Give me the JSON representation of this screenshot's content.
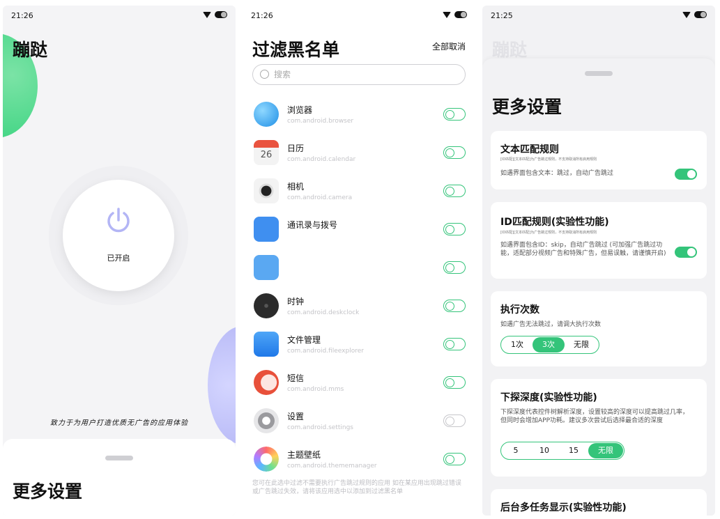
{
  "screens": {
    "main": {
      "time": "21:26",
      "app_title": "蹦跶",
      "power_label": "已开启",
      "slogan": "致力于为用户打造优质无广告的应用体验",
      "sheet_title": "更多设置"
    },
    "blacklist": {
      "time": "21:26",
      "title": "过滤黑名单",
      "deselect_all": "全部取消",
      "search_placeholder": "搜索",
      "apps": [
        {
          "name": "浏览器",
          "pkg": "com.android.browser",
          "on": false
        },
        {
          "name": "日历",
          "pkg": "com.android.calendar",
          "on": false
        },
        {
          "name": "相机",
          "pkg": "com.android.camera",
          "on": false
        },
        {
          "name": "通讯录与拨号",
          "pkg": "",
          "on": false
        },
        {
          "name": "",
          "pkg": "",
          "on": false
        },
        {
          "name": "时钟",
          "pkg": "com.android.deskclock",
          "on": false
        },
        {
          "name": "文件管理",
          "pkg": "com.android.fileexplorer",
          "on": false
        },
        {
          "name": "短信",
          "pkg": "com.android.mms",
          "on": false
        },
        {
          "name": "设置",
          "pkg": "com.android.settings",
          "on": false
        },
        {
          "name": "主题壁纸",
          "pkg": "com.android.thememanager",
          "on": false
        }
      ],
      "footnote": "您可在此选中过滤不需要执行广告跳过规则的应用 如在某应用出现跳过错误或广告跳过失效，请将该应用选中以添加到过滤黑名单"
    },
    "settings": {
      "time": "21:25",
      "behind_title": "蹦跶",
      "title": "更多设置",
      "text_rule": {
        "title": "文本匹配规则",
        "small": "[ID匹配][文本匹配]为广告跳过规则，不支持取消所有启用规则",
        "desc": "如遇界面包含文本：跳过，自动广告跳过"
      },
      "id_rule": {
        "title": "ID匹配规则(实验性功能)",
        "small": "[ID匹配][文本匹配]为广告跳过规则，不支持取消所有启用规则",
        "desc": "如遇界面包含ID：skip，自动广告跳过 (可加强广告跳过功能，适配部分视频广告和特殊广告，但易误触，请谨慎开启)"
      },
      "exec_count": {
        "title": "执行次数",
        "desc": "如遇广告无法跳过，请调大执行次数",
        "options": [
          "1次",
          "3次",
          "无限"
        ],
        "selected": "3次"
      },
      "depth": {
        "title": "下探深度(实验性功能)",
        "desc": "下探深度代表控件树解析深度，设置较高的深度可以提高跳过几率，但同时会增加APP功耗。建议多次尝试后选择最合适的深度",
        "options": [
          "5",
          "10",
          "15",
          "无限"
        ],
        "selected": "无限"
      },
      "multitask": {
        "title": "后台多任务显示(实验性功能)"
      }
    }
  },
  "colors": {
    "accent": "#34c47a",
    "power_icon": "#b3b5f5"
  }
}
